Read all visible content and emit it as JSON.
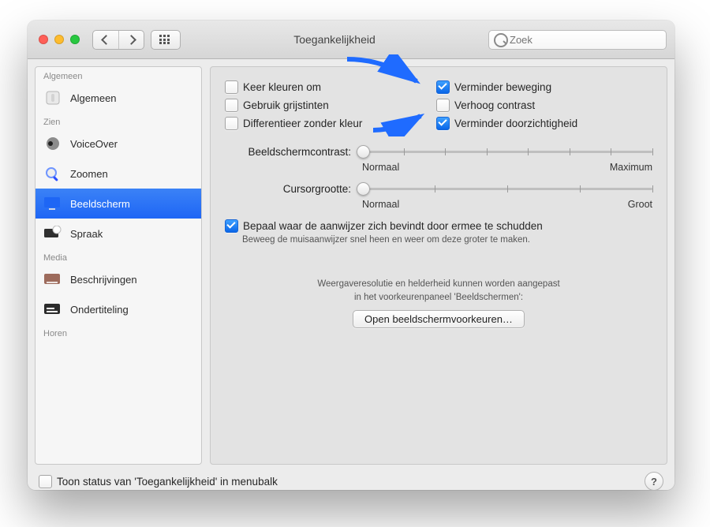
{
  "window": {
    "title": "Toegankelijkheid"
  },
  "search": {
    "placeholder": "Zoek"
  },
  "sidebar": {
    "groups": {
      "general": "Algemeen",
      "vision": "Zien",
      "media": "Media",
      "hearing": "Horen"
    },
    "items": {
      "general": "Algemeen",
      "voiceover": "VoiceOver",
      "zoom": "Zoomen",
      "display": "Beeldscherm",
      "speech": "Spraak",
      "descriptions": "Beschrijvingen",
      "subtitles": "Ondertiteling"
    }
  },
  "display": {
    "invert": {
      "label": "Keer kleuren om",
      "checked": false
    },
    "grayscale": {
      "label": "Gebruik grijstinten",
      "checked": false
    },
    "diffNoColor": {
      "label": "Differentieer zonder kleur",
      "checked": false
    },
    "reduceMotion": {
      "label": "Verminder beweging",
      "checked": true
    },
    "increaseContrast": {
      "label": "Verhoog contrast",
      "checked": false
    },
    "reduceTransparency": {
      "label": "Verminder doorzichtigheid",
      "checked": true
    },
    "contrast": {
      "label": "Beeldschermcontrast:",
      "minText": "Normaal",
      "maxText": "Maximum"
    },
    "cursor": {
      "label": "Cursorgrootte:",
      "minText": "Normaal",
      "maxText": "Groot"
    },
    "shake": {
      "checked": true,
      "label": "Bepaal waar de aanwijzer zich bevindt door ermee te schudden",
      "sub": "Beweeg de muisaanwijzer snel heen en weer om deze groter te maken."
    },
    "note1": "Weergaveresolutie en helderheid kunnen worden aangepast",
    "note2": "in het voorkeurenpaneel 'Beeldschermen':",
    "openDisplaysButton": "Open beeldschermvoorkeuren…"
  },
  "bottom": {
    "showInMenubar": {
      "label": "Toon status van 'Toegankelijkheid' in menubalk",
      "checked": false
    }
  }
}
